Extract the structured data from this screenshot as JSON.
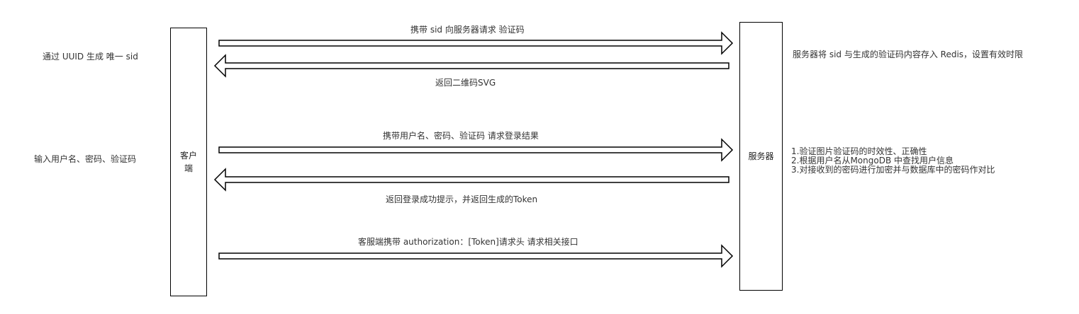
{
  "actors": {
    "client_lines": [
      "客户",
      "端"
    ],
    "server": "服务器"
  },
  "side_notes": {
    "uuid": "通过 UUID 生成 唯一 sid",
    "input": "输入用户名、密码、验证码",
    "redis": "服务器将 sid 与生成的验证码内容存入 Redis，设置有效时限",
    "verify_steps": [
      "1.验证图片验证码的时效性、正确性",
      "2.根据用户名从MongoDB 中查找用户信息",
      "3.对接收到的密码进行加密并与数据库中的密码作对比"
    ]
  },
  "messages": [
    {
      "text": "携带 sid 向服务器请求 验证码",
      "direction": "to-server"
    },
    {
      "text": "返回二维码SVG",
      "direction": "to-client"
    },
    {
      "text": "携带用户名、密码、验证码 请求登录结果",
      "direction": "to-server"
    },
    {
      "text": "返回登录成功提示，并返回生成的Token",
      "direction": "to-client"
    },
    {
      "text": "客服端携带 authorization：[Token]请求头 请求相关接口",
      "direction": "to-server"
    }
  ],
  "colors": {
    "stroke": "#000000",
    "text": "#333333"
  }
}
